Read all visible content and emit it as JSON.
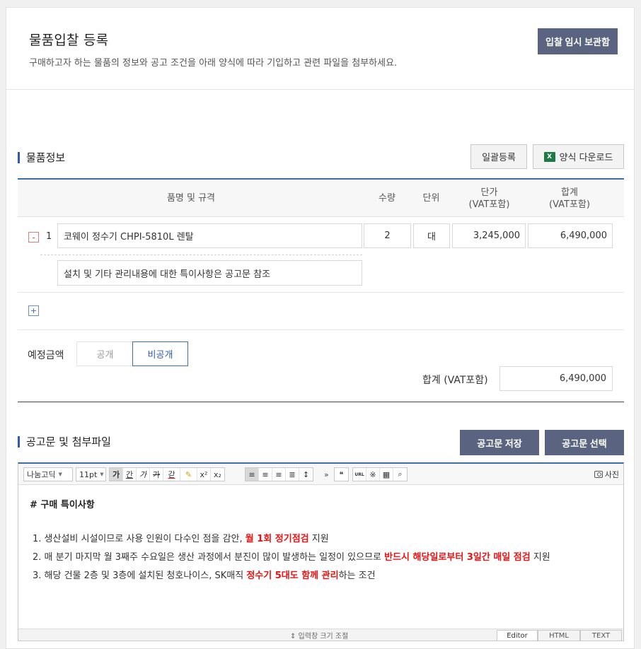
{
  "header": {
    "title": "물품입찰 등록",
    "description": "구매하고자 하는 물품의 정보와 공고 조건을 아래 양식에 따라 기입하고 관련 파일을 첨부하세요.",
    "temp_save_label": "입찰 임시 보관함"
  },
  "items_section": {
    "title": "물품정보",
    "bulk_label": "일괄등록",
    "form_download_label": "양식 다운로드",
    "columns": {
      "name": "품명 및 규격",
      "qty": "수량",
      "unit": "단위",
      "price_line1": "단가",
      "price_line2": "(VAT포함)",
      "total_line1": "합계",
      "total_line2": "(VAT포함)"
    },
    "rows": [
      {
        "num": "1",
        "name": "코웨이 정수기 CHPI-5810L 렌탈",
        "qty": "2",
        "unit": "대",
        "price": "3,245,000",
        "total": "6,490,000",
        "note": "설치 및 기타 관리내용에 대한 특이사항은 공고문 참조"
      }
    ],
    "remove_symbol": "-",
    "add_symbol": "+",
    "estimated_label": "예정금액",
    "public_label": "공개",
    "private_label": "비공개",
    "sum_label": "합계 (VAT포함)",
    "sum_value": "6,490,000"
  },
  "notice_section": {
    "title": "공고문 및 첨부파일",
    "save_label": "공고문 저장",
    "select_label": "공고문 선택"
  },
  "editor": {
    "font_select": "나눔고딕",
    "size_select": "11pt",
    "format_buttons": [
      "가",
      "간",
      "가",
      "가",
      "갇"
    ],
    "photo_label": "사진",
    "heading": "# 구매 특이사항",
    "lines": [
      {
        "prefix": "1. 생산설비 시설이므로 사용 인원이 다수인 점을 감안, ",
        "highlight": "월 1회 정기점검",
        "suffix": " 지원"
      },
      {
        "prefix": "2. 매 분기 마지막 월 3째주 수요일은 생산 과정에서 분진이 많이 발생하는 일정이 있으므로 ",
        "highlight": "반드시 해당일로부터 3일간 매일 점검",
        "suffix": " 지원"
      },
      {
        "prefix": "3. 해당 건물 2층 및 3층에 설치된 청호나이스, SK매직 ",
        "highlight": "정수기 5대도 함께 관리",
        "suffix": "하는 조건"
      }
    ],
    "resize_label": "⇕ 입력창 크기 조절",
    "modes": [
      "Editor",
      "HTML",
      "TEXT"
    ]
  },
  "colors": {
    "accent": "#3b6fa8",
    "dark_button": "#5a6480",
    "highlight_red": "#e11111"
  }
}
